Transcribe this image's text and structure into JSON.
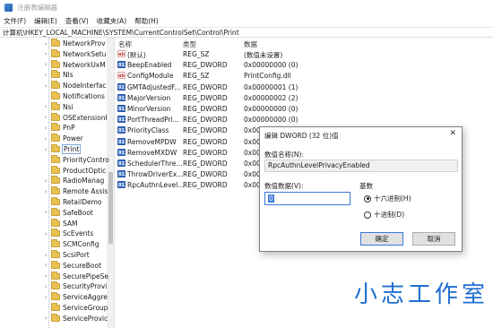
{
  "window": {
    "title": "注册表编辑器"
  },
  "menu": [
    "文件(F)",
    "编辑(E)",
    "查看(V)",
    "收藏夹(A)",
    "帮助(H)"
  ],
  "address": "计算机\\HKEY_LOCAL_MACHINE\\SYSTEM\\CurrentControlSet\\Control\\Print",
  "tree": {
    "items": [
      {
        "label": "NetworkProv",
        "expandable": true
      },
      {
        "label": "NetworkSetu",
        "expandable": true
      },
      {
        "label": "NetworkUxM",
        "expandable": true
      },
      {
        "label": "Nls",
        "expandable": true
      },
      {
        "label": "NodeInterfac",
        "expandable": true
      },
      {
        "label": "Notifications",
        "expandable": false
      },
      {
        "label": "Nsi",
        "expandable": true
      },
      {
        "label": "OSExtensionI",
        "expandable": true
      },
      {
        "label": "PnP",
        "expandable": true
      },
      {
        "label": "Power",
        "expandable": true
      },
      {
        "label": "Print",
        "expandable": true,
        "selected": true
      },
      {
        "label": "PriorityContro",
        "expandable": false
      },
      {
        "label": "ProductOptic",
        "expandable": false
      },
      {
        "label": "RadioManag",
        "expandable": true
      },
      {
        "label": "Remote Assis",
        "expandable": true
      },
      {
        "label": "RetailDemo",
        "expandable": false
      },
      {
        "label": "SafeBoot",
        "expandable": true
      },
      {
        "label": "SAM",
        "expandable": false
      },
      {
        "label": "ScEvents",
        "expandable": true
      },
      {
        "label": "SCMConfig",
        "expandable": false
      },
      {
        "label": "ScsiPort",
        "expandable": true
      },
      {
        "label": "SecureBoot",
        "expandable": true
      },
      {
        "label": "SecurePipeSe",
        "expandable": true
      },
      {
        "label": "SecurityProvi",
        "expandable": true
      },
      {
        "label": "ServiceAggre",
        "expandable": true
      },
      {
        "label": "ServiceGroup",
        "expandable": false
      },
      {
        "label": "ServiceProvic",
        "expandable": true
      }
    ]
  },
  "values": {
    "headers": {
      "name": "名称",
      "type": "类型",
      "data": "数据"
    },
    "rows": [
      {
        "icon": "ab",
        "name": "(默认)",
        "type": "REG_SZ",
        "data": "(数值未设置)"
      },
      {
        "icon": "dw",
        "name": "BeepEnabled",
        "type": "REG_DWORD",
        "data": "0x00000000 (0)"
      },
      {
        "icon": "ab",
        "name": "ConfigModule",
        "type": "REG_SZ",
        "data": "PrintConfig.dll"
      },
      {
        "icon": "dw",
        "name": "GMTAdjustedF...",
        "type": "REG_DWORD",
        "data": "0x00000001 (1)"
      },
      {
        "icon": "dw",
        "name": "MajorVersion",
        "type": "REG_DWORD",
        "data": "0x00000002 (2)"
      },
      {
        "icon": "dw",
        "name": "MinorVersion",
        "type": "REG_DWORD",
        "data": "0x00000000 (0)"
      },
      {
        "icon": "dw",
        "name": "PortThreadPri...",
        "type": "REG_DWORD",
        "data": "0x00000000 (0)"
      },
      {
        "icon": "dw",
        "name": "PriorityClass",
        "type": "REG_DWORD",
        "data": "0x00"
      },
      {
        "icon": "dw",
        "name": "RemoveMPDW",
        "type": "REG_DWORD",
        "data": "0x00"
      },
      {
        "icon": "dw",
        "name": "RemoveMXDW",
        "type": "REG_DWORD",
        "data": "0x00"
      },
      {
        "icon": "dw",
        "name": "SchedulerThre...",
        "type": "REG_DWORD",
        "data": "0x00"
      },
      {
        "icon": "dw",
        "name": "ThrowDriverEx...",
        "type": "REG_DWORD",
        "data": "0x00"
      },
      {
        "icon": "dw",
        "name": "RpcAuthnLevel...",
        "type": "REG_DWORD",
        "data": "0x00"
      }
    ]
  },
  "dialog": {
    "title": "编辑 DWORD (32 位)值",
    "close_glyph": "✕",
    "name_label": "数值名称(N):",
    "name_value": "RpcAuthnLevelPrivacyEnabled",
    "data_label": "数值数据(V):",
    "data_value": "0",
    "base_label": "基数",
    "hex_label": "十六进制(H)",
    "dec_label": "十进制(D)",
    "selected_base": "hex",
    "ok_label": "确定",
    "cancel_label": "取消"
  },
  "watermark": "小志工作室",
  "colors": {
    "accent": "#3b78d8",
    "watermark": "#1f6fd1",
    "folder": "#e8c153"
  }
}
